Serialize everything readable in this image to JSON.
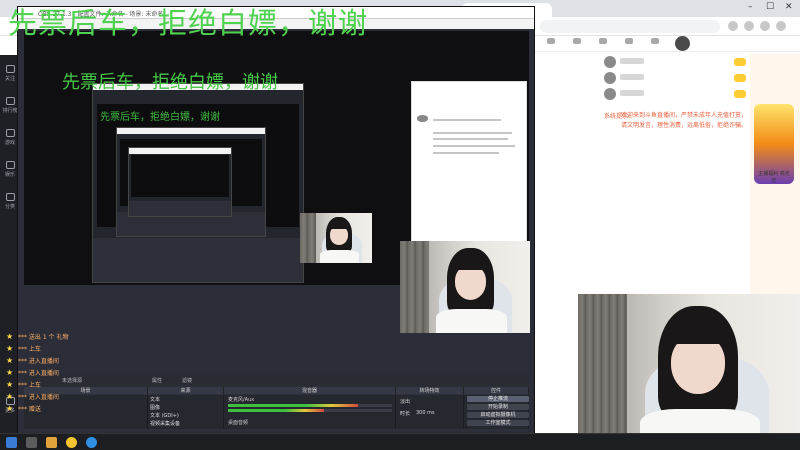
{
  "watermark": {
    "primary": "先票后车，拒绝白嫖，谢谢",
    "secondary": "先票后车，拒绝白嫖，谢谢",
    "tertiary": "先票后车，拒绝白嫖，谢谢"
  },
  "colors": {
    "watermark": "#4fd24f",
    "obs_bg": "#2b2e38",
    "stage_bg": "#101114",
    "chat_notice": "#e8603c",
    "viewer_text": "#ffb067",
    "meter_green": "#3fbf3f",
    "meter_yellow": "#e0c93c",
    "meter_red": "#d24b3b"
  },
  "sidebar": {
    "items": [
      {
        "icon": "home-icon",
        "label": "关注"
      },
      {
        "icon": "list-icon",
        "label": "排行榜"
      },
      {
        "icon": "game-icon",
        "label": "游戏"
      },
      {
        "icon": "entertainment-icon",
        "label": "娱乐"
      },
      {
        "icon": "category-icon",
        "label": "分类"
      },
      {
        "icon": "more-icon",
        "label": "更多"
      }
    ]
  },
  "chat": {
    "notice_label": "系统提示:",
    "notice_text": "欢迎来到斗鱼直播间，严禁未成年人充值打赏，请文明发言，理性消费，远离低俗，拒绝诈骗。"
  },
  "promo": {
    "text": "主播福利 高光定"
  },
  "obs": {
    "title": "OBS 27.1.3 - 配置文件: 未命名 - 场景: 未命名",
    "toolbar": {
      "left": "未选择源",
      "properties": "属性",
      "filters": "滤镜"
    },
    "docks": {
      "scenes": "场景",
      "sources": "来源",
      "mixer": "混音器",
      "transitions": "转场特效",
      "controls": "控件"
    },
    "sources": [
      {
        "name": "文本"
      },
      {
        "name": "图像"
      },
      {
        "name": "文本 (GDI+)"
      },
      {
        "name": "视频采集设备"
      }
    ],
    "mixer": {
      "channel1": "桌面音频",
      "channel2": "麦克风/Aux"
    },
    "transition": {
      "type": "淡出",
      "duration_label": "时长",
      "duration_value": "300 ms"
    },
    "controls": [
      {
        "label": "停止推流",
        "active": true
      },
      {
        "label": "开始录制"
      },
      {
        "label": "启动虚拟摄像机"
      },
      {
        "label": "工作室模式"
      }
    ]
  },
  "viewers": [
    {
      "text": "*** 送出 1 个 礼物"
    },
    {
      "text": "*** 上车"
    },
    {
      "text": "*** 进入直播间"
    },
    {
      "text": "*** 进入直播间"
    },
    {
      "text": "*** 上车"
    },
    {
      "text": "*** 进入直播间"
    },
    {
      "text": "*** 赠送"
    }
  ]
}
